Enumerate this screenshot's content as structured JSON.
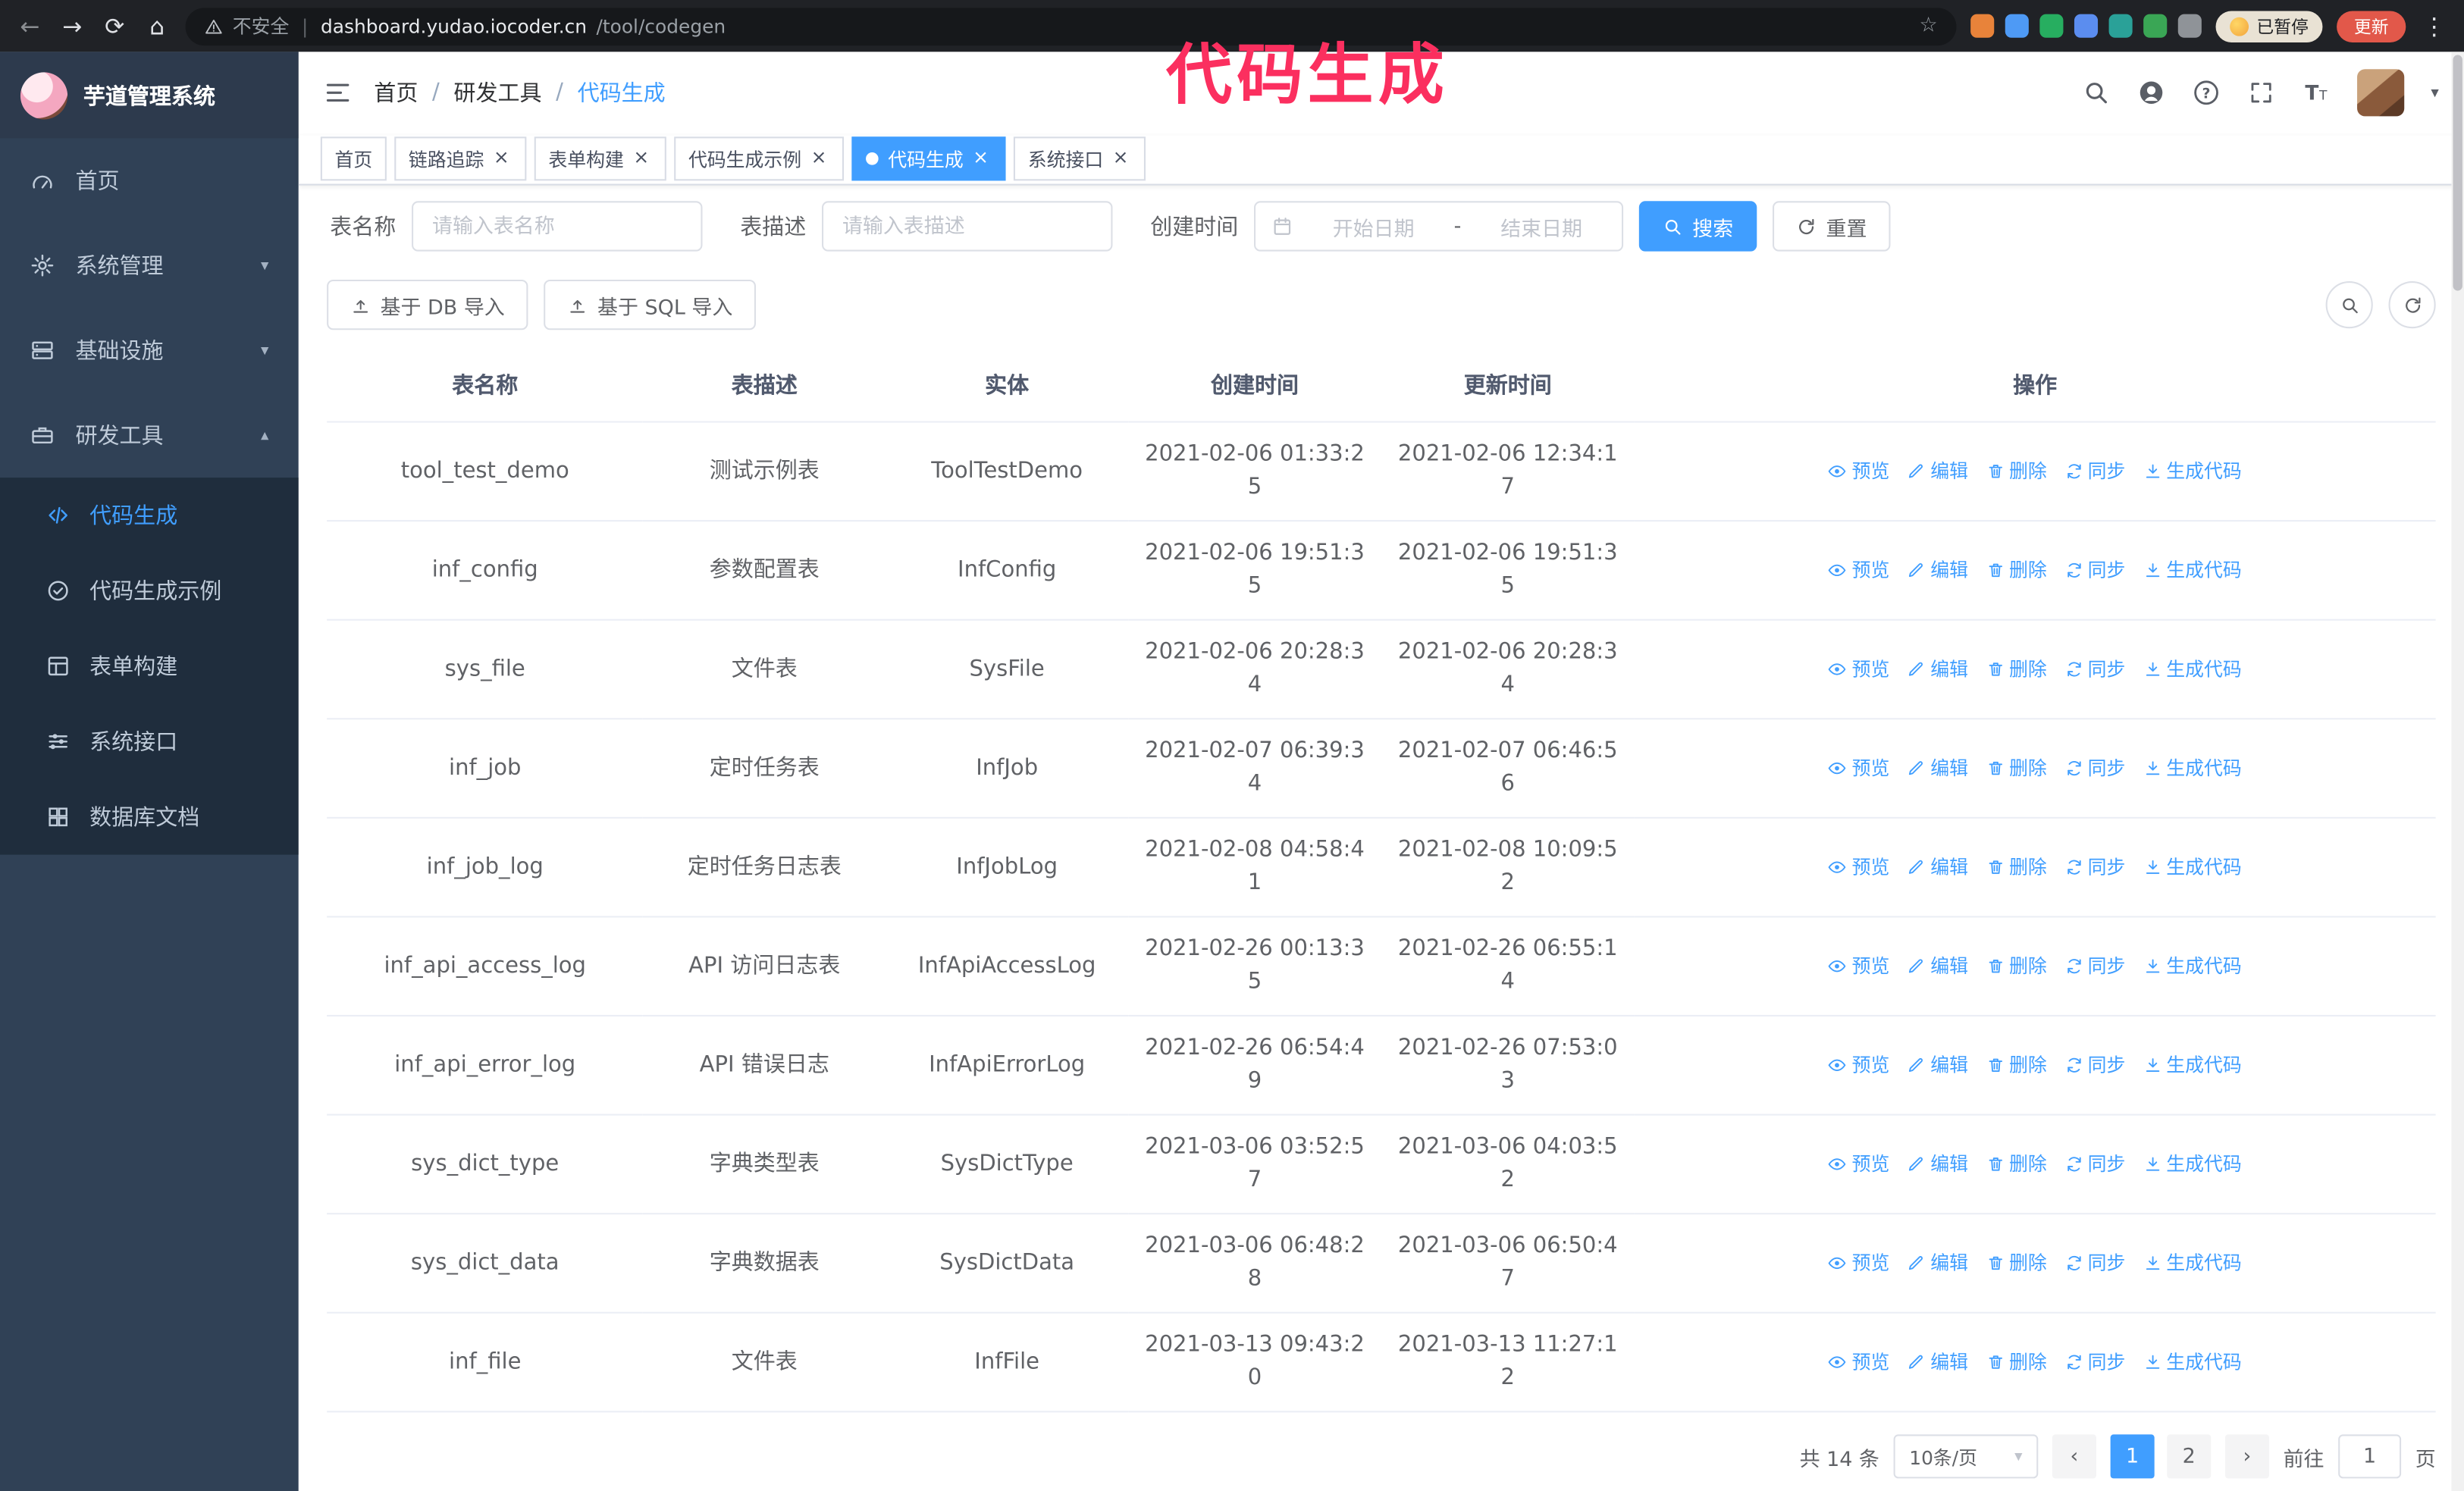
{
  "colors": {
    "accent": "#409eff",
    "sidebar_bg": "#304156",
    "submenu_bg": "#1f2d3d",
    "annotation": "#fb2f5f",
    "active_tab": "#409eff"
  },
  "icons": {
    "back": "←",
    "forward": "→",
    "reload": "⟳",
    "home": "⌂",
    "star": "☆",
    "menu": "⋮",
    "caret_down": "▾",
    "caret_up": "▴",
    "prev": "‹",
    "next": "›",
    "close": "×",
    "divider": "|"
  },
  "browser": {
    "security_label": "不安全",
    "url_host": "dashboard.yudao.iocoder.cn",
    "url_path": "/tool/codegen",
    "paused_badge": "已暂停",
    "update_label": "更新",
    "extensions": [
      {
        "name": "extension-orange-icon",
        "color": "#e8833a"
      },
      {
        "name": "extension-drop-icon",
        "color": "#4e9af5"
      },
      {
        "name": "extension-check-icon",
        "color": "#27ae60"
      },
      {
        "name": "extension-people-icon",
        "color": "#5b8def"
      },
      {
        "name": "extension-capture-icon",
        "color": "#2aa198"
      },
      {
        "name": "extension-leaf-icon",
        "color": "#3aa655"
      },
      {
        "name": "extension-puzzle-icon",
        "color": "#8f9398"
      }
    ]
  },
  "annotation": {
    "text": "代码生成"
  },
  "sidebar": {
    "title": "芋道管理系统",
    "items": [
      {
        "id": "home",
        "label": "首页",
        "icon": "gauge"
      },
      {
        "id": "system",
        "label": "系统管理",
        "icon": "gear",
        "expandable": true
      },
      {
        "id": "infra",
        "label": "基础设施",
        "icon": "server",
        "expandable": true
      },
      {
        "id": "dev",
        "label": "研发工具",
        "icon": "tools",
        "expandable": true,
        "expanded": true
      }
    ],
    "submenu": [
      {
        "id": "codegen",
        "label": "代码生成",
        "icon": "code",
        "active": true
      },
      {
        "id": "codegen-demo",
        "label": "代码生成示例",
        "icon": "example"
      },
      {
        "id": "form-builder",
        "label": "表单构建",
        "icon": "form"
      },
      {
        "id": "api",
        "label": "系统接口",
        "icon": "api"
      },
      {
        "id": "db-doc",
        "label": "数据库文档",
        "icon": "doc"
      }
    ]
  },
  "breadcrumb": [
    "首页",
    "研发工具",
    "代码生成"
  ],
  "tabs": [
    {
      "label": "首页",
      "closable": false
    },
    {
      "label": "链路追踪",
      "closable": true
    },
    {
      "label": "表单构建",
      "closable": true
    },
    {
      "label": "代码生成示例",
      "closable": true
    },
    {
      "label": "代码生成",
      "closable": true,
      "active": true
    },
    {
      "label": "系统接口",
      "closable": true
    }
  ],
  "filters": {
    "table_name_label": "表名称",
    "table_name_placeholder": "请输入表名称",
    "table_desc_label": "表描述",
    "table_desc_placeholder": "请输入表描述",
    "create_time_label": "创建时间",
    "start_placeholder": "开始日期",
    "range_separator": "-",
    "end_placeholder": "结束日期",
    "search_label": "搜索",
    "reset_label": "重置"
  },
  "toolbar": {
    "import_db": "基于 DB 导入",
    "import_sql": "基于 SQL 导入"
  },
  "table": {
    "columns": [
      "表名称",
      "表描述",
      "实体",
      "创建时间",
      "更新时间",
      "操作"
    ],
    "ops": [
      {
        "name": "preview",
        "label": "预览",
        "icon": "eye"
      },
      {
        "name": "edit",
        "label": "编辑",
        "icon": "edit"
      },
      {
        "name": "delete",
        "label": "删除",
        "icon": "del"
      },
      {
        "name": "sync",
        "label": "同步",
        "icon": "sync"
      },
      {
        "name": "generate",
        "label": "生成代码",
        "icon": "down"
      }
    ],
    "rows": [
      {
        "name": "tool_test_demo",
        "desc": "测试示例表",
        "entity": "ToolTestDemo",
        "created": "2021-02-06 01:33:25",
        "updated": "2021-02-06 12:34:17"
      },
      {
        "name": "inf_config",
        "desc": "参数配置表",
        "entity": "InfConfig",
        "created": "2021-02-06 19:51:35",
        "updated": "2021-02-06 19:51:35"
      },
      {
        "name": "sys_file",
        "desc": "文件表",
        "entity": "SysFile",
        "created": "2021-02-06 20:28:34",
        "updated": "2021-02-06 20:28:34"
      },
      {
        "name": "inf_job",
        "desc": "定时任务表",
        "entity": "InfJob",
        "created": "2021-02-07 06:39:34",
        "updated": "2021-02-07 06:46:56"
      },
      {
        "name": "inf_job_log",
        "desc": "定时任务日志表",
        "entity": "InfJobLog",
        "created": "2021-02-08 04:58:41",
        "updated": "2021-02-08 10:09:52"
      },
      {
        "name": "inf_api_access_log",
        "desc": "API 访问日志表",
        "entity": "InfApiAccessLog",
        "created": "2021-02-26 00:13:35",
        "updated": "2021-02-26 06:55:14"
      },
      {
        "name": "inf_api_error_log",
        "desc": "API 错误日志",
        "entity": "InfApiErrorLog",
        "created": "2021-02-26 06:54:49",
        "updated": "2021-02-26 07:53:03"
      },
      {
        "name": "sys_dict_type",
        "desc": "字典类型表",
        "entity": "SysDictType",
        "created": "2021-03-06 03:52:57",
        "updated": "2021-03-06 04:03:52"
      },
      {
        "name": "sys_dict_data",
        "desc": "字典数据表",
        "entity": "SysDictData",
        "created": "2021-03-06 06:48:28",
        "updated": "2021-03-06 06:50:47"
      },
      {
        "name": "inf_file",
        "desc": "文件表",
        "entity": "InfFile",
        "created": "2021-03-13 09:43:20",
        "updated": "2021-03-13 11:27:12"
      }
    ]
  },
  "pagination": {
    "total": "共 14 条",
    "page_size": "10条/页",
    "pages": [
      "1",
      "2"
    ],
    "active_page": "1",
    "goto_label": "前往",
    "goto_value": "1",
    "page_unit": "页"
  }
}
